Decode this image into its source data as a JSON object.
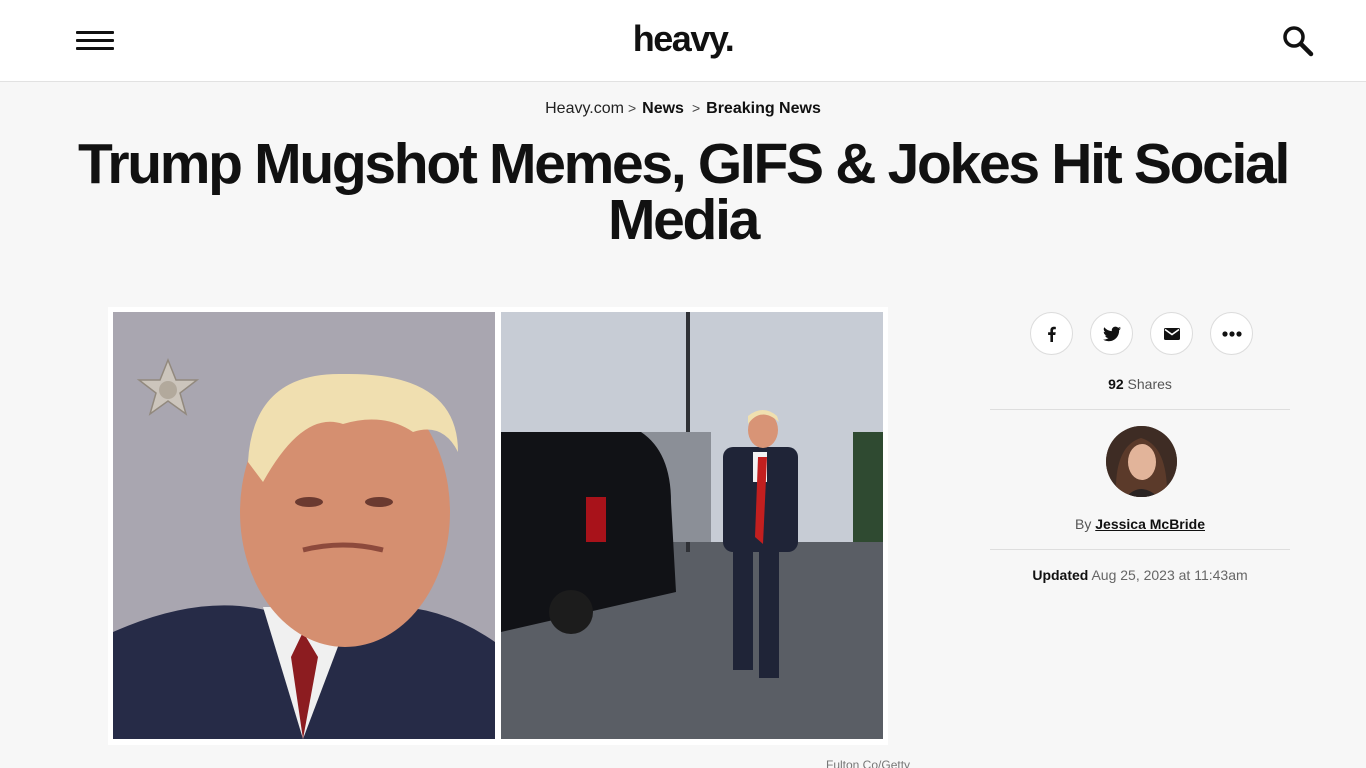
{
  "header": {
    "logo": "heavy.",
    "menu_icon": "hamburger-menu-icon",
    "search_icon": "search-icon"
  },
  "breadcrumb": {
    "items": [
      "Heavy.com",
      "News",
      "Breaking News"
    ],
    "separator": ">"
  },
  "article": {
    "title": "Trump Mugshot Memes, GIFS & Jokes Hit Social Media",
    "image_caption": "Fulton Co/Getty"
  },
  "share": {
    "buttons": [
      "facebook-icon",
      "twitter-icon",
      "email-icon",
      "more-icon"
    ],
    "count": "92",
    "label": "Shares"
  },
  "author": {
    "by_label": "By",
    "name": "Jessica McBride"
  },
  "updated": {
    "label": "Updated",
    "date": "Aug 25, 2023 at 11:43am"
  }
}
